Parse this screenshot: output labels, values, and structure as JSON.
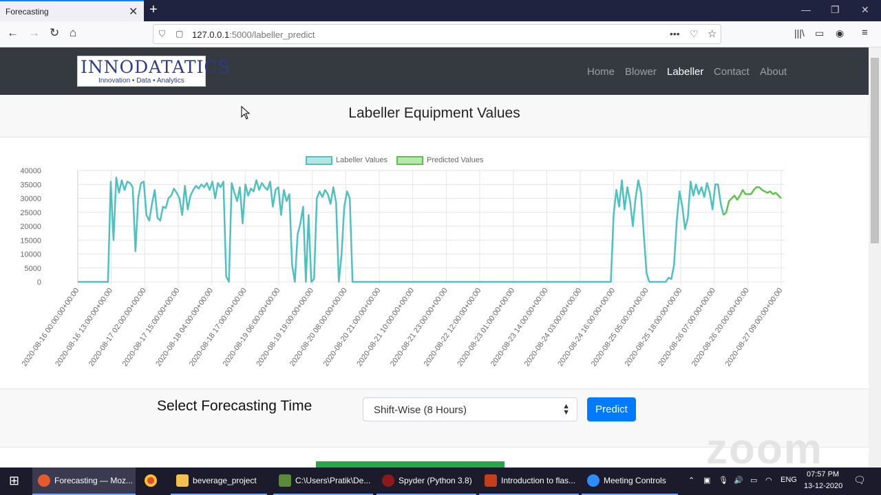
{
  "browser": {
    "tab_title": "Forecasting",
    "url_host": "127.0.0.1",
    "url_path": ":5000/labeller_predict"
  },
  "site": {
    "logo_main": "INNODATATICS",
    "logo_sub": "Innovation • Data • Analytics",
    "nav": [
      "Home",
      "Blower",
      "Labeller",
      "Contact",
      "About"
    ],
    "active_nav": "Labeller"
  },
  "main": {
    "title": "Labeller Equipment Values",
    "control_label": "Select Forecasting Time",
    "select_value": "Shift-Wise (8 Hours)",
    "predict_label": "Predict"
  },
  "chart_data": {
    "type": "line",
    "legend": [
      "Labeller Values",
      "Predicted Values"
    ],
    "colors": {
      "labeller": "#4dc0c0",
      "predicted": "#5cc34a"
    },
    "ylim": [
      0,
      40000
    ],
    "yticks": [
      0,
      5000,
      10000,
      15000,
      20000,
      25000,
      30000,
      35000,
      40000
    ],
    "xtick_labels": [
      "2020-08-16 00:00:00+00:00",
      "2020-08-16 13:00:00+00:00",
      "2020-08-17 02:00:00+00:00",
      "2020-08-17 15:00:00+00:00",
      "2020-08-18 04:00:00+00:00",
      "2020-08-18 17:00:00+00:00",
      "2020-08-19 06:00:00+00:00",
      "2020-08-19 19:00:00+00:00",
      "2020-08-20 08:00:00+00:00",
      "2020-08-20 21:00:00+00:00",
      "2020-08-21 10:00:00+00:00",
      "2020-08-21 23:00:00+00:00",
      "2020-08-22 12:00:00+00:00",
      "2020-08-23 01:00:00+00:00",
      "2020-08-23 14:00:00+00:00",
      "2020-08-24 03:00:00+00:00",
      "2020-08-24 16:00:00+00:00",
      "2020-08-25 05:00:00+00:00",
      "2020-08-25 18:00:00+00:00",
      "2020-08-26 07:00:00+00:00",
      "2020-08-26 20:00:00+00:00",
      "2020-08-27 09:00:00+00:00"
    ],
    "series": [
      {
        "name": "Labeller Values",
        "values": [
          0,
          0,
          0,
          0,
          0,
          0,
          0,
          0,
          0,
          0,
          0,
          0,
          36000,
          15000,
          37500,
          32000,
          36500,
          33000,
          36000,
          35500,
          34000,
          11000,
          30000,
          35500,
          36000,
          24000,
          22000,
          28000,
          33000,
          23000,
          22000,
          27000,
          26500,
          30000,
          31000,
          33500,
          32000,
          30000,
          24000,
          34500,
          26000,
          31000,
          33000,
          34500,
          33500,
          35000,
          34000,
          35500,
          33000,
          36000,
          30000,
          35500,
          34000,
          36000,
          2000,
          0,
          35500,
          32000,
          29000,
          34000,
          21000,
          35000,
          31000,
          33500,
          32500,
          36500,
          33000,
          35500,
          34000,
          33000,
          36000,
          27000,
          33000,
          34000,
          24000,
          33000,
          29000,
          31500,
          6000,
          0,
          17000,
          21000,
          27000,
          0,
          24000,
          0,
          1000,
          30000,
          32500,
          30500,
          33000,
          31500,
          28000,
          34000,
          28500,
          0,
          10000,
          27000,
          32500,
          30000,
          0,
          0,
          0,
          0,
          0,
          0,
          0,
          0,
          0,
          0,
          0,
          0,
          0,
          0,
          0,
          0,
          0,
          0,
          0,
          0,
          0,
          0,
          0,
          0,
          0,
          0,
          0,
          0,
          0,
          0,
          0,
          0,
          0,
          0,
          0,
          0,
          0,
          0,
          0,
          0,
          0,
          0,
          0,
          0,
          0,
          0,
          0,
          0,
          0,
          0,
          0,
          0,
          0,
          0,
          0,
          0,
          0,
          0,
          0,
          0,
          0,
          0,
          0,
          0,
          0,
          0,
          0,
          0,
          0,
          0,
          0,
          0,
          0,
          0,
          0,
          0,
          0,
          0,
          0,
          0,
          0,
          0,
          0,
          0,
          0,
          0,
          0,
          0,
          0,
          0,
          0,
          0,
          0,
          0,
          0,
          24000,
          33000,
          27000,
          36500,
          26000,
          34000,
          29000,
          20000,
          30000,
          36500,
          32000,
          17000,
          3000,
          0,
          0,
          0,
          0,
          0,
          0,
          0,
          1500,
          1000,
          6000,
          22000,
          32500,
          27000,
          19000,
          23000,
          36000,
          31000,
          35000,
          31500,
          34000,
          30500,
          35500,
          32000,
          26000,
          35000,
          35000,
          28000,
          24000
        ]
      },
      {
        "name": "Predicted Values",
        "values": [
          24000,
          25000,
          29000,
          30000,
          31000,
          29500,
          31000,
          33000,
          31500,
          31500,
          31500,
          33000,
          34000,
          34000,
          33000,
          32500,
          32000,
          32500,
          31500,
          32000,
          31000,
          30000
        ]
      }
    ]
  },
  "taskbar": {
    "items": [
      "Forecasting — Moz...",
      "",
      "beverage_project",
      "C:\\Users\\Pratik\\De...",
      "Spyder (Python 3.8)",
      "Introduction to flas...",
      "Meeting Controls"
    ],
    "lang": "ENG",
    "time": "07:57 PM",
    "date": "13-12-2020"
  },
  "watermark": "zoom"
}
